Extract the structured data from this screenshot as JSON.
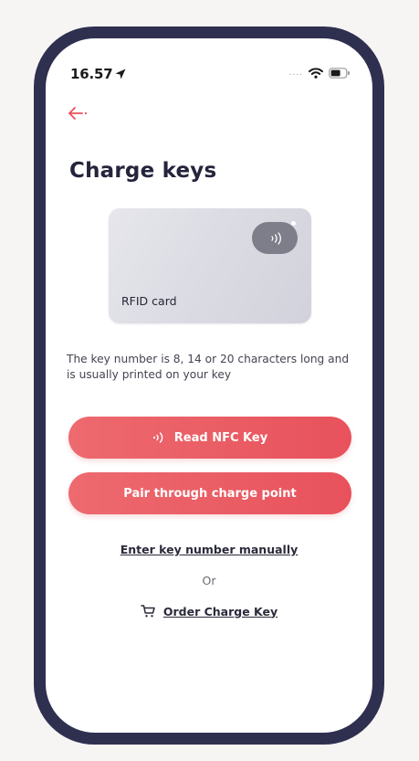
{
  "status_bar": {
    "time": "16.57",
    "signal": "....",
    "icons": [
      "location-arrow-icon",
      "wifi-icon",
      "battery-icon"
    ]
  },
  "header": {
    "back_icon": "arrow-left-icon",
    "title": "Charge keys"
  },
  "card": {
    "label": "RFID card",
    "icon": "nfc-icon"
  },
  "description": "The key number is 8, 14 or 20 characters long and is usually printed on your key",
  "actions": {
    "read_nfc_label": "Read NFC Key",
    "pair_label": "Pair through charge point",
    "manual_label": "Enter key number manually",
    "or_label": "Or",
    "order_label": "Order Charge Key"
  },
  "colors": {
    "accent": "#e8525c",
    "title": "#24243d",
    "frame": "#2f3050"
  }
}
